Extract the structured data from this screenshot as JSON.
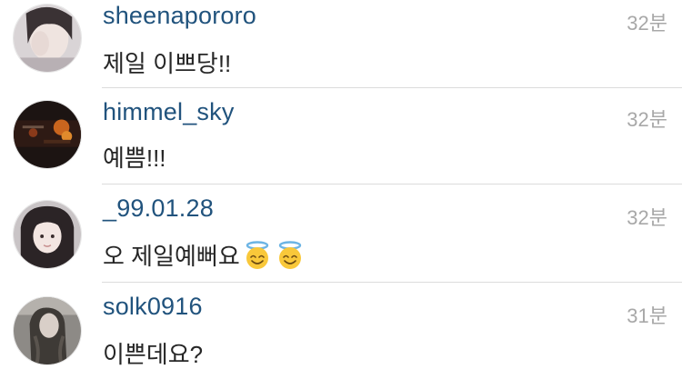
{
  "comments": [
    {
      "username": "sheenapororo",
      "text": "제일 이쁘당!!",
      "time": "32분",
      "emojis": []
    },
    {
      "username": "himmel_sky",
      "text": "예쁨!!!",
      "time": "32분",
      "emojis": []
    },
    {
      "username": "_99.01.28",
      "text": "오 제일예뻐요",
      "time": "32분",
      "emojis": [
        "smiling-face-with-halo-icon",
        "smiling-face-with-halo-icon"
      ]
    },
    {
      "username": "solk0916",
      "text": "이쁜데요?",
      "time": "31분",
      "emojis": []
    }
  ]
}
